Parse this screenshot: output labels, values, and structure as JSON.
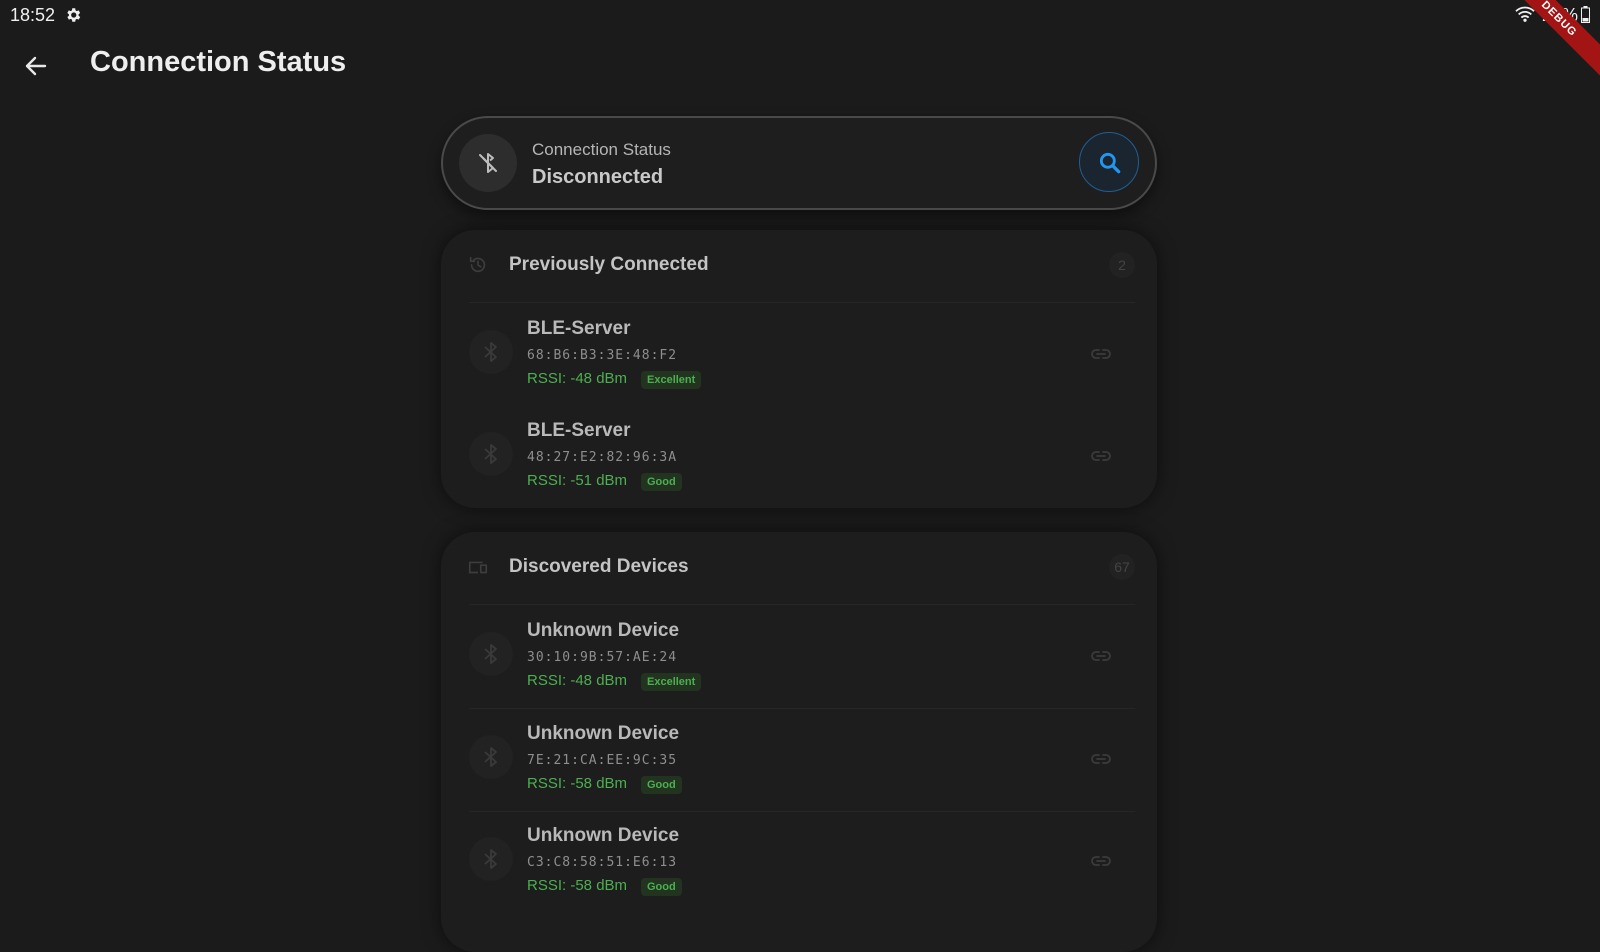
{
  "status_bar": {
    "time": "18:52",
    "battery": "21%"
  },
  "debug_banner": "DEBUG",
  "app_bar": {
    "title": "Connection Status"
  },
  "connection": {
    "label": "Connection Status",
    "value": "Disconnected"
  },
  "sections": {
    "previous": {
      "title": "Previously Connected",
      "count": "2",
      "devices": [
        {
          "name": "BLE-Server",
          "mac": "68:B6:B3:3E:48:F2",
          "rssi": "RSSI: -48 dBm",
          "quality": "Excellent"
        },
        {
          "name": "BLE-Server",
          "mac": "48:27:E2:82:96:3A",
          "rssi": "RSSI: -51 dBm",
          "quality": "Good"
        }
      ]
    },
    "discovered": {
      "title": "Discovered Devices",
      "count": "67",
      "devices": [
        {
          "name": "Unknown Device",
          "mac": "30:10:9B:57:AE:24",
          "rssi": "RSSI: -48 dBm",
          "quality": "Excellent"
        },
        {
          "name": "Unknown Device",
          "mac": "7E:21:CA:EE:9C:35",
          "rssi": "RSSI: -58 dBm",
          "quality": "Good"
        },
        {
          "name": "Unknown Device",
          "mac": "C3:C8:58:51:E6:13",
          "rssi": "RSSI: -58 dBm",
          "quality": "Good"
        }
      ]
    }
  },
  "colors": {
    "background": "#1b1b1b",
    "accent_blue": "#2196f3",
    "signal_green": "#4caf50",
    "debug_red": "#a31515"
  },
  "icons": {
    "status_settings": "gear-icon",
    "status_wifi": "wifi-icon",
    "status_battery": "battery-icon",
    "back": "arrow-back-icon",
    "connection": "bluetooth-disabled-icon",
    "scan": "search-icon",
    "previous_section": "history-icon",
    "discovered_section": "devices-icon",
    "device": "bluetooth-icon",
    "connect": "link-icon"
  }
}
